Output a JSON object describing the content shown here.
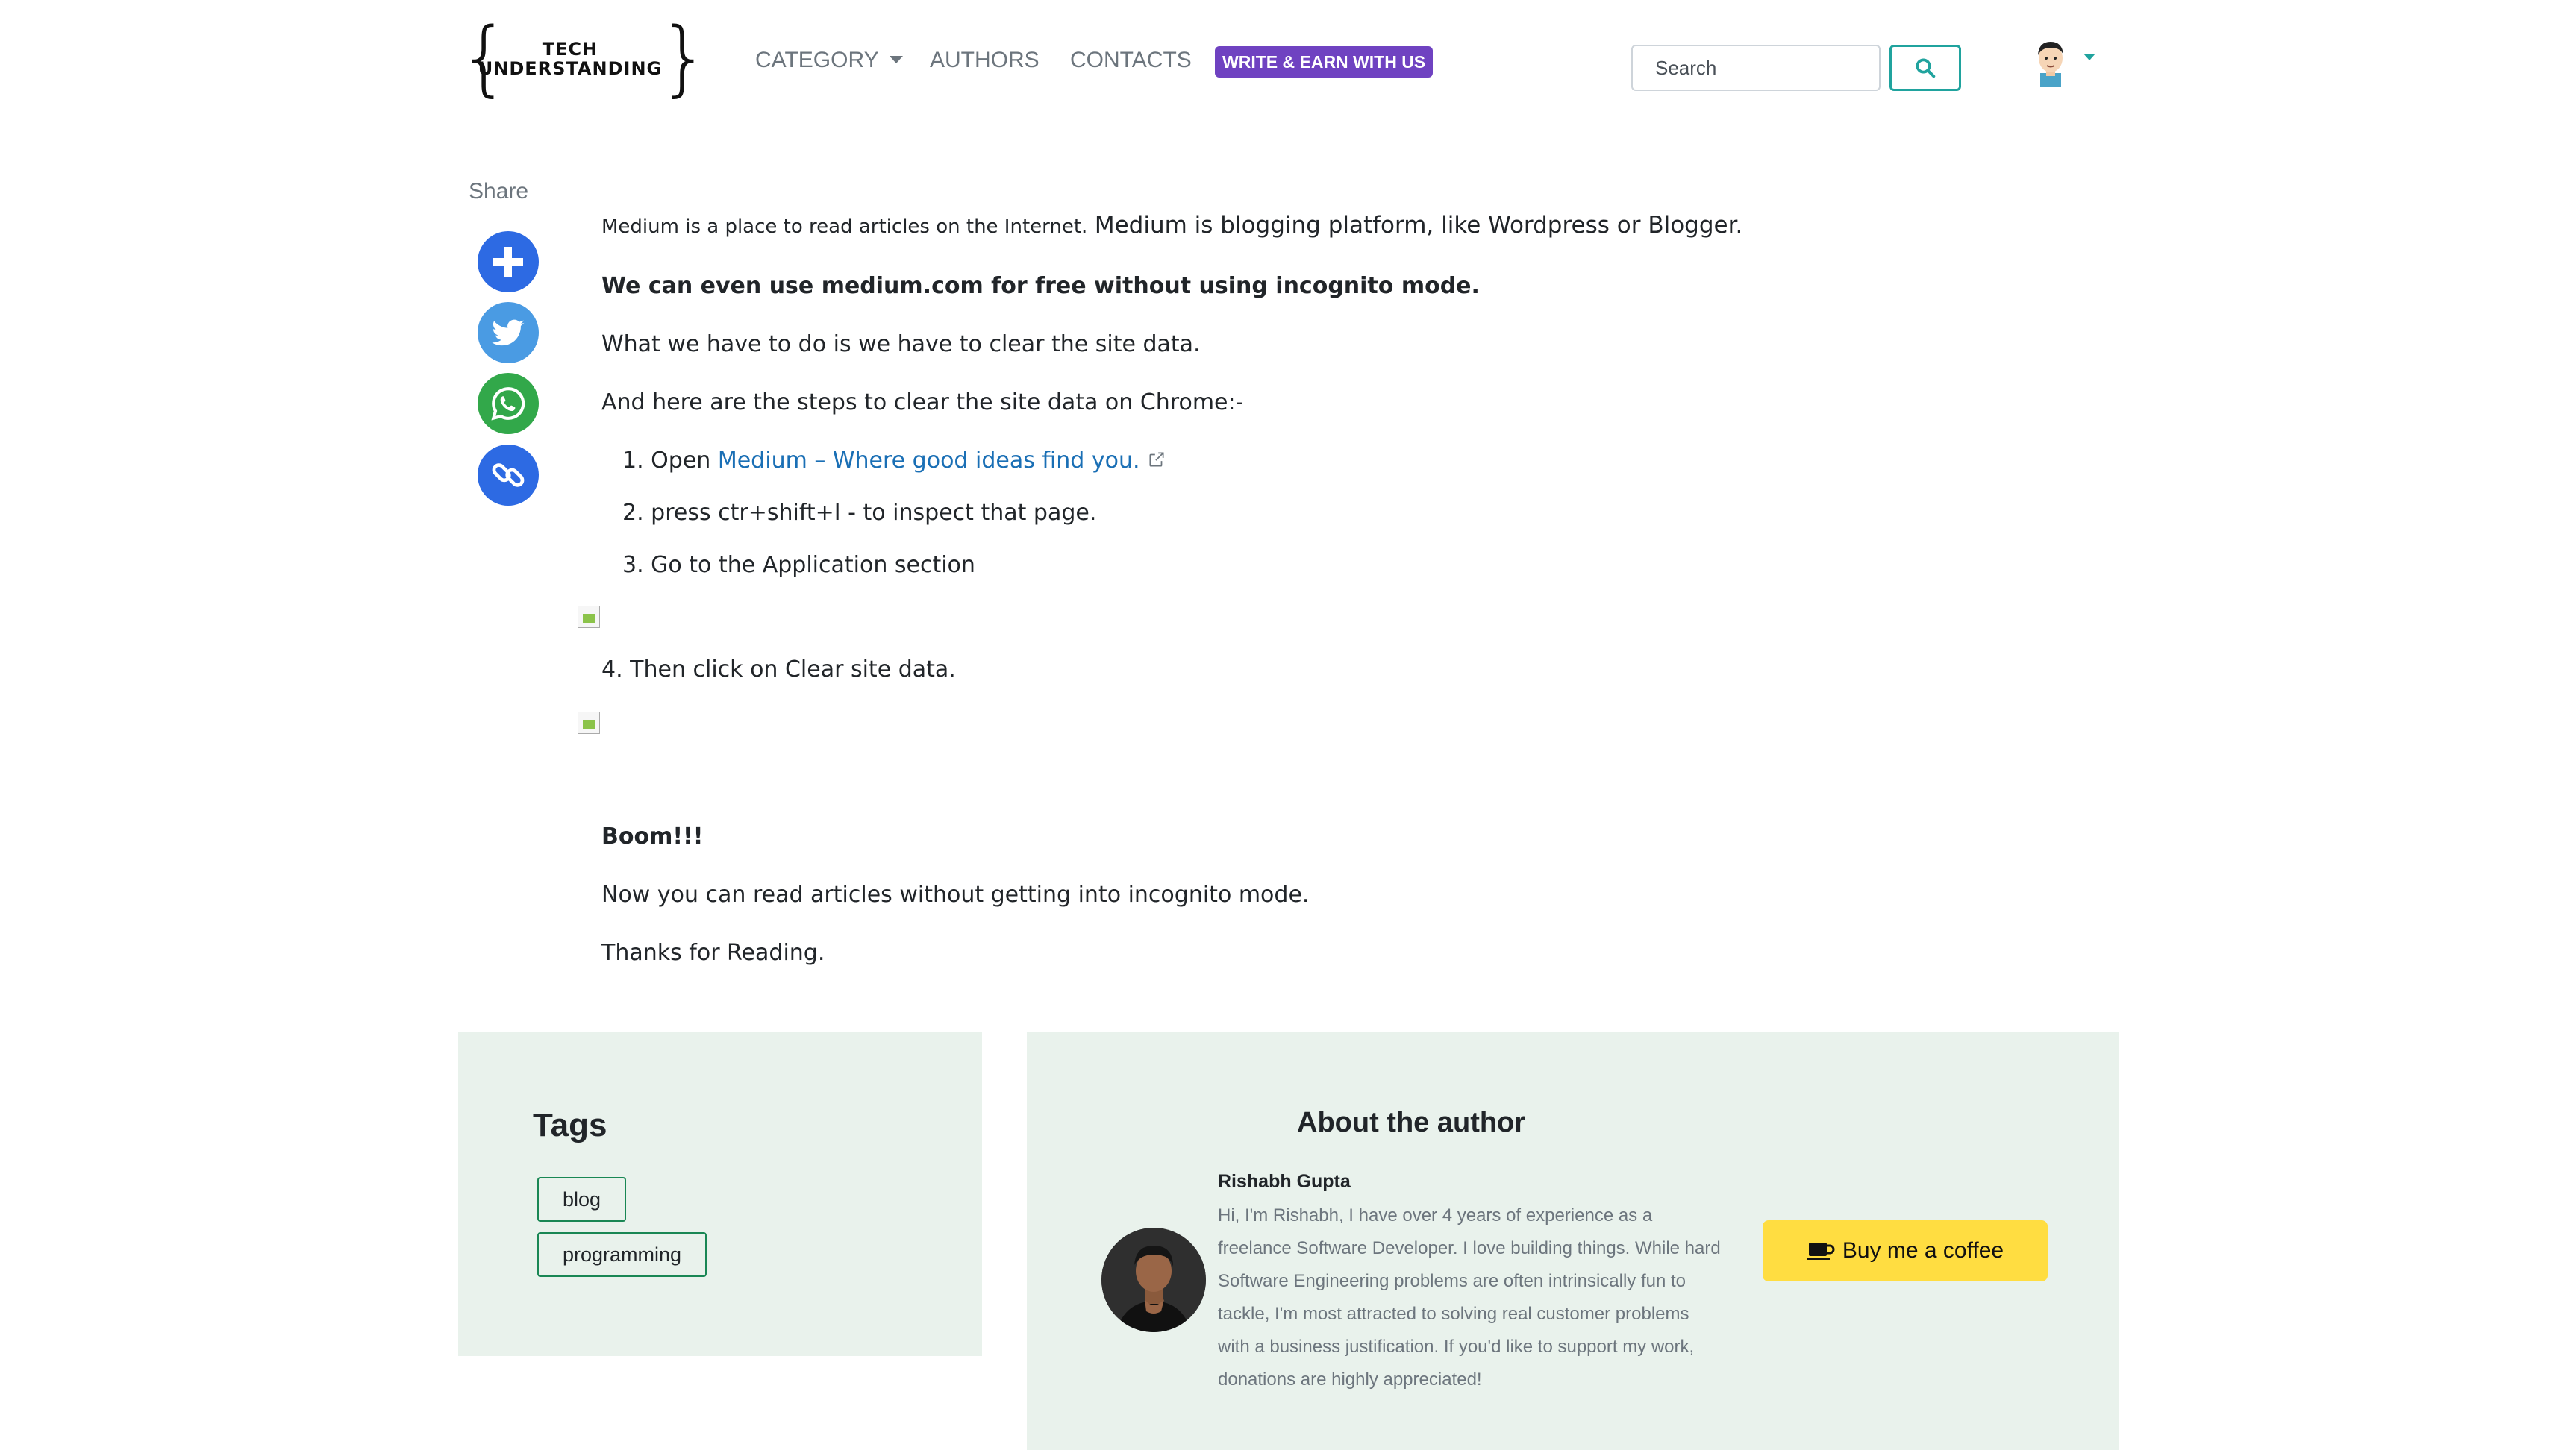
{
  "nav": {
    "logo_top": "TECH",
    "logo_bottom": "UNDERSTANDING",
    "category": "CATEGORY",
    "authors": "AUTHORS",
    "contacts": "CONTACTS",
    "write_earn": "WRITE & EARN WITH US",
    "search_placeholder": "Search",
    "search_icon": "search-icon",
    "accent_color": "#20a39e",
    "badge_color": "#6f42c1"
  },
  "share": {
    "label": "Share",
    "buttons": [
      {
        "icon": "plus-icon",
        "color": "#2d6ae3"
      },
      {
        "icon": "twitter-icon",
        "color": "#4a9be3"
      },
      {
        "icon": "whatsapp-icon",
        "color": "#32a84a"
      },
      {
        "icon": "link-icon",
        "color": "#2d6ae3"
      }
    ]
  },
  "article": {
    "intro_small": "Medium is a place to read articles on the Internet.",
    "intro_large": "Medium is blogging platform, like Wordpress or Blogger.",
    "bold_line": "We can even use medium.com for free without using incognito mode.",
    "p_what": "What we have to do is we have to clear the site data.",
    "p_steps": "And here are the steps to clear the site data on Chrome:-",
    "step1_prefix": "1. Open",
    "step1_link": "Medium – Where good ideas find you.",
    "step2": "2. press ctr+shift+I - to inspect that page.",
    "step3": "3. Go to the Application section",
    "step4": "4. Then click on Clear site data.",
    "boom": "Boom!!!",
    "now": "Now you can read articles without getting into incognito mode.",
    "thanks": "Thanks for Reading."
  },
  "tags": {
    "title": "Tags",
    "items": [
      "blog",
      "programming"
    ]
  },
  "about": {
    "title": "About the author",
    "name": "Rishabh Gupta",
    "bio": "Hi, I'm Rishabh, I have over 4 years of experience as a freelance Software Developer. I love building things. While hard Software Engineering problems are often intrinsically fun to tackle, I'm most attracted to solving real customer problems with a business justification. If you'd like to support my work, donations are highly appreciated!",
    "coffee_label": "Buy me a coffee",
    "coffee_color": "#ffdd41",
    "panel_color": "#e9f2ec"
  }
}
